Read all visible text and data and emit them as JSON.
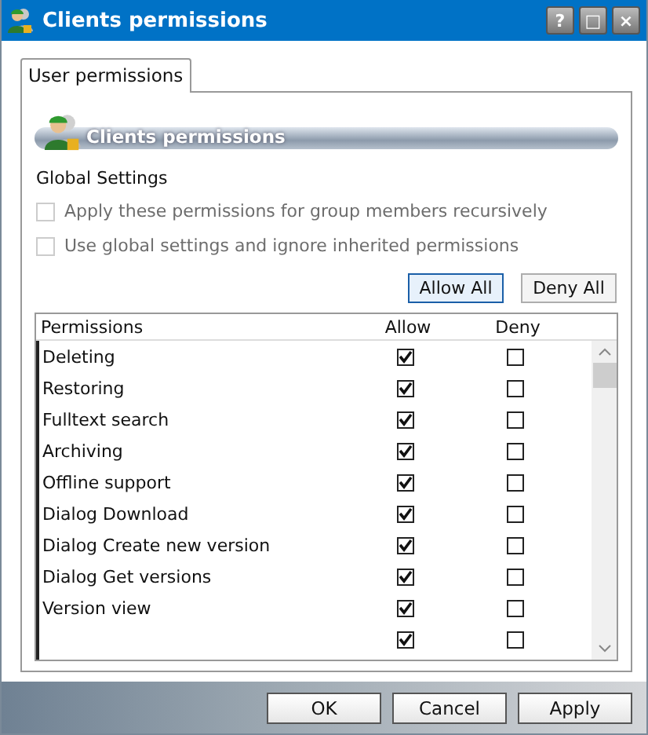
{
  "window": {
    "title": "Clients permissions",
    "controls": [
      "?",
      "□",
      "×"
    ]
  },
  "tabs": [
    {
      "label": "User permissions",
      "selected": true
    }
  ],
  "section_header": {
    "title": "Clients permissions"
  },
  "global_settings": {
    "title": "Global Settings",
    "options": [
      {
        "label": "Apply these permissions for group members recursively",
        "checked": false,
        "disabled": true
      },
      {
        "label": "Use global settings and ignore inherited permissions",
        "checked": false,
        "disabled": true
      }
    ]
  },
  "bulk_buttons": [
    {
      "label": "Allow All",
      "focused": true
    },
    {
      "label": "Deny All",
      "focused": false
    }
  ],
  "table": {
    "columns": [
      "Permissions",
      "Allow",
      "Deny"
    ],
    "rows": [
      {
        "name": "Deleting",
        "allow": true,
        "deny": false
      },
      {
        "name": "Restoring",
        "allow": true,
        "deny": false
      },
      {
        "name": "Fulltext search",
        "allow": true,
        "deny": false
      },
      {
        "name": "Archiving",
        "allow": true,
        "deny": false
      },
      {
        "name": "Offline support",
        "allow": true,
        "deny": false
      },
      {
        "name": "Dialog Download",
        "allow": true,
        "deny": false
      },
      {
        "name": "Dialog Create new version",
        "allow": true,
        "deny": false
      },
      {
        "name": "Dialog Get versions",
        "allow": true,
        "deny": false
      },
      {
        "name": "Version view",
        "allow": true,
        "deny": false
      },
      {
        "allow": true,
        "deny": false
      }
    ]
  },
  "buttons": [
    "OK",
    "Cancel",
    "Apply"
  ]
}
